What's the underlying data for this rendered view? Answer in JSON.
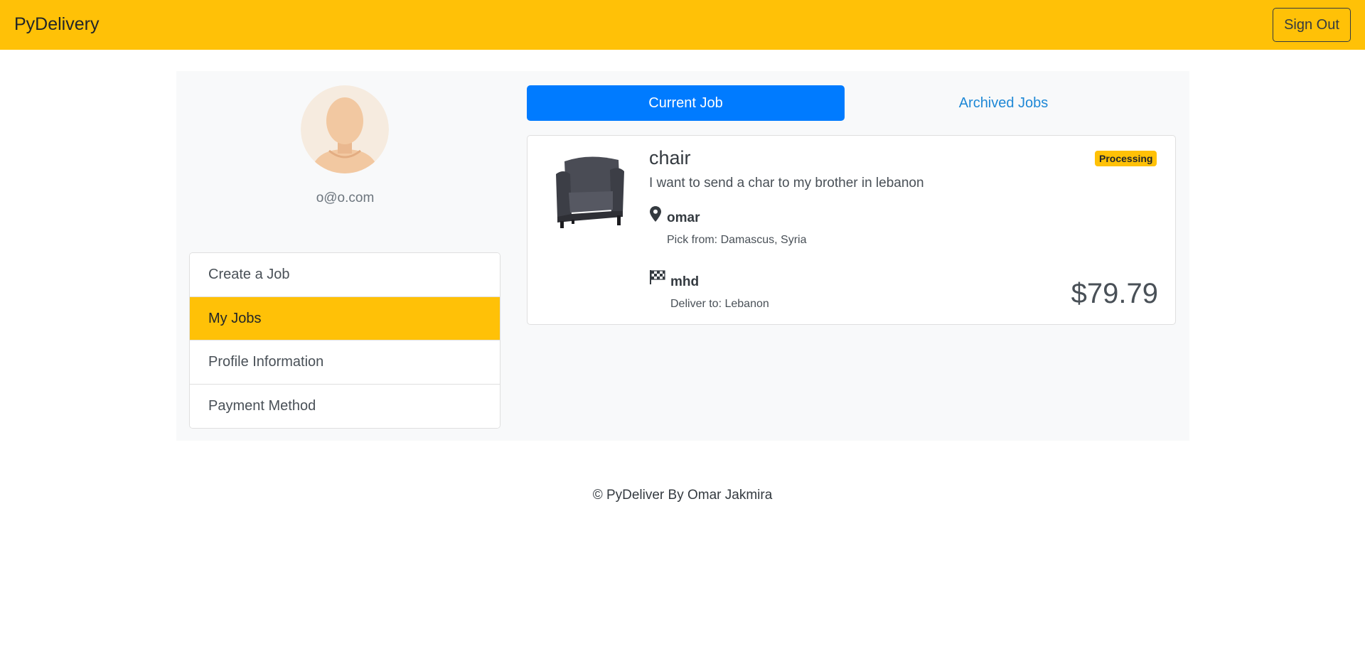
{
  "navbar": {
    "brand": "PyDelivery",
    "signout_label": "Sign Out"
  },
  "profile": {
    "email": "o@o.com"
  },
  "menu": {
    "items": [
      {
        "label": "Create a Job"
      },
      {
        "label": "My Jobs"
      },
      {
        "label": "Profile Information"
      },
      {
        "label": "Payment Method"
      }
    ]
  },
  "tabs": {
    "current": "Current Job",
    "archived": "Archived Jobs"
  },
  "job": {
    "title": "chair",
    "description": "I want to send a char to my brother in lebanon",
    "status": "Processing",
    "pickup": {
      "name": "omar",
      "address": "Pick from: Damascus, Syria"
    },
    "delivery": {
      "name": "mhd",
      "address": "Deliver to: Lebanon"
    },
    "price": "$79.79"
  },
  "footer": {
    "text": "© PyDeliver By Omar Jakmira"
  },
  "colors": {
    "accent": "#ffc107",
    "primary": "#007bff",
    "link": "#1e88d6"
  }
}
